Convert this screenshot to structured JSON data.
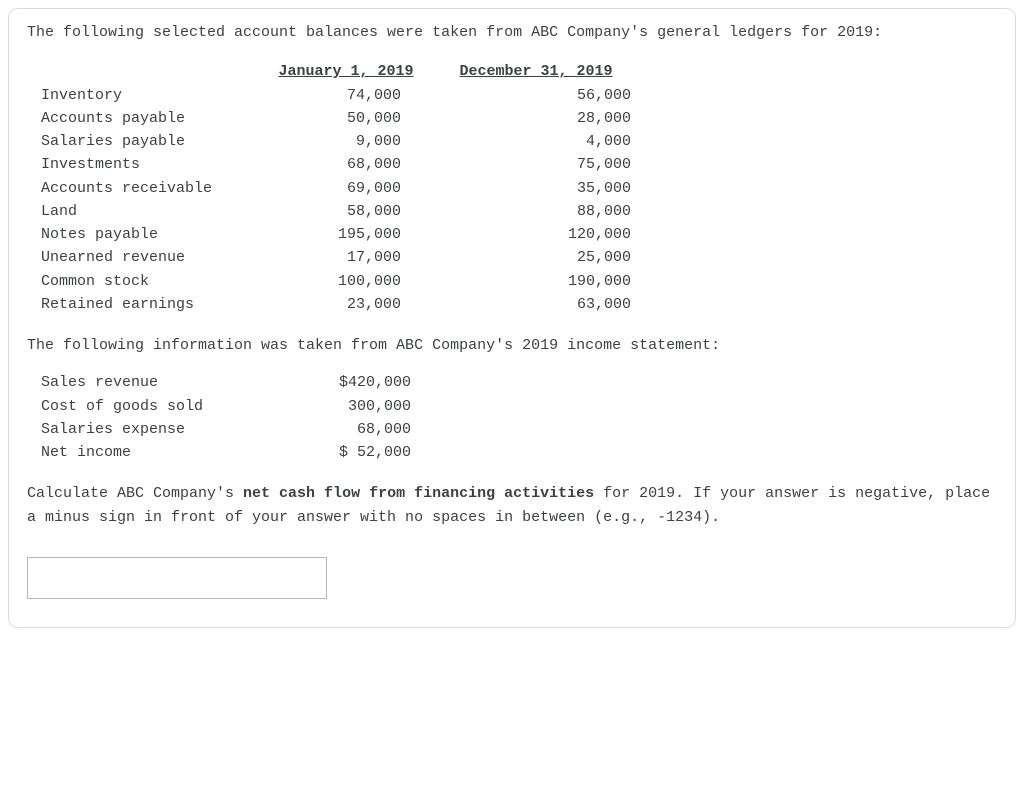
{
  "intro": "The following selected account balances were taken from ABC Company's general ledgers for 2019:",
  "balances": {
    "head_jan": "January 1, 2019",
    "head_dec": "December 31, 2019",
    "rows": [
      {
        "label": "Inventory",
        "jan": "74,000",
        "dec": "56,000"
      },
      {
        "label": "Accounts payable",
        "jan": "50,000",
        "dec": "28,000"
      },
      {
        "label": "Salaries payable",
        "jan": "9,000",
        "dec": "4,000"
      },
      {
        "label": "Investments",
        "jan": "68,000",
        "dec": "75,000"
      },
      {
        "label": "Accounts receivable",
        "jan": "69,000",
        "dec": "35,000"
      },
      {
        "label": "Land",
        "jan": "58,000",
        "dec": "88,000"
      },
      {
        "label": "Notes payable",
        "jan": "195,000",
        "dec": "120,000"
      },
      {
        "label": "Unearned revenue",
        "jan": "17,000",
        "dec": "25,000"
      },
      {
        "label": "Common stock",
        "jan": "100,000",
        "dec": "190,000"
      },
      {
        "label": "Retained earnings",
        "jan": "23,000",
        "dec": "63,000"
      }
    ]
  },
  "mid": "The following information was taken from ABC Company's 2019 income statement:",
  "income": {
    "rows": [
      {
        "label": "Sales revenue",
        "val": "$420,000"
      },
      {
        "label": "Cost of goods sold",
        "val": "300,000"
      },
      {
        "label": "Salaries expense",
        "val": "68,000"
      },
      {
        "label": "Net income",
        "val": "$ 52,000"
      }
    ]
  },
  "question": {
    "pre": "Calculate ABC Company's ",
    "bold": "net cash flow from financing activities",
    "post": " for 2019. If your answer is negative, place a minus sign in front of your answer with no spaces in between (e.g., -1234)."
  },
  "answer_value": ""
}
